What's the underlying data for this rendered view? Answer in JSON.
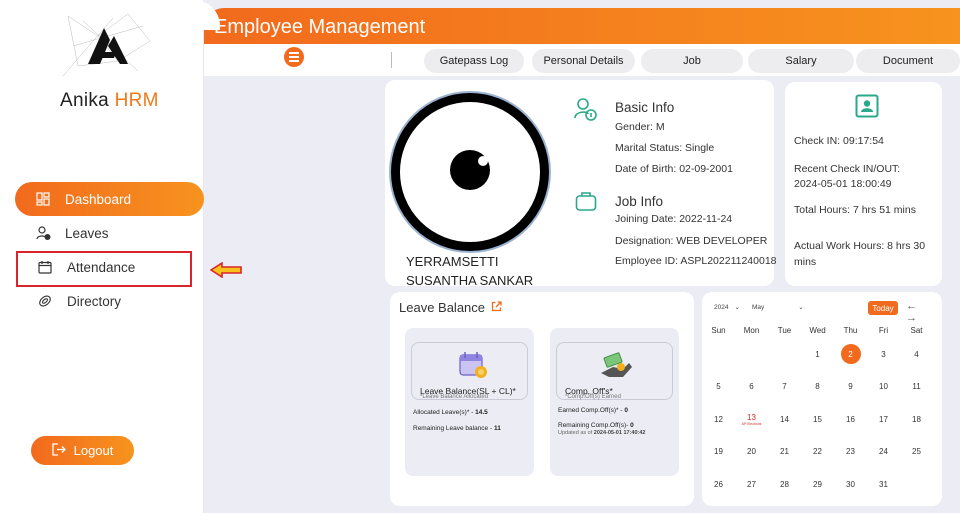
{
  "app": {
    "brand_main": "Anika",
    "brand_accent": "HRM"
  },
  "header": {
    "title": "Employee Management"
  },
  "sidebar": {
    "items": [
      {
        "label": "Dashboard",
        "icon": "dashboard-icon",
        "active": true
      },
      {
        "label": "Leaves",
        "icon": "leaves-icon",
        "active": false
      },
      {
        "label": "Attendance",
        "icon": "calendar-icon",
        "active": false
      },
      {
        "label": "Directory",
        "icon": "directory-icon",
        "active": false
      }
    ],
    "logout_label": "Logout"
  },
  "tabs": [
    "Gatepass Log",
    "Personal Details",
    "Job",
    "Salary",
    "Document"
  ],
  "profile": {
    "name_line1": "YERRAMSETTI",
    "name_line2": "SUSANTHA SANKAR",
    "basic_info_title": "Basic Info",
    "gender": "Gender: M",
    "marital": "Marital Status: Single",
    "dob": "Date of Birth: 02-09-2001",
    "job_info_title": "Job Info",
    "joining": "Joining Date: 2022-11-24",
    "designation": "Designation: WEB DEVELOPER",
    "employee_id": "Employee ID: ASPL202211240018"
  },
  "checkin": {
    "check_in": "Check IN: 09:17:54",
    "recent_label": "Recent Check IN/OUT:",
    "recent_value": "2024-05-01 18:00:49",
    "total_hours": "Total Hours: 7 hrs 51 mins",
    "actual_line1": "Actual Work Hours: 8 hrs 30",
    "actual_line2": "mins"
  },
  "leave_balance": {
    "title": "Leave Balance",
    "card1": {
      "name": "Leave Balance(SL + CL)*",
      "sub": "*Leave Balance Allocated",
      "allocated_label": "Allocated Leave(s)* - ",
      "allocated_value": "14.5",
      "remaining_label": "Remaining Leave balance - ",
      "remaining_value": "11"
    },
    "card2": {
      "name": "Comp. Off's*",
      "sub": "*Comp.Off(s) Earned",
      "earned_label": "Earned Comp.Off(s)* - ",
      "earned_value": "0",
      "remaining_label": "Remaining Comp.Off(s)- ",
      "remaining_value": "0",
      "updated_label": "Updated as of ",
      "updated_value": "2024-05-01 17:40:42"
    }
  },
  "calendar": {
    "year": "2024",
    "month": "May",
    "today_label": "Today",
    "arrows": "← →",
    "weekdays": [
      "Sun",
      "Mon",
      "Tue",
      "Wed",
      "Thu",
      "Fri",
      "Sat"
    ],
    "today_day": "2",
    "holiday_day": "13",
    "holiday_note": "AP Elections",
    "weeks": [
      [
        "",
        "",
        "",
        "1",
        "2",
        "3",
        "4"
      ],
      [
        "5",
        "6",
        "7",
        "8",
        "9",
        "10",
        "11"
      ],
      [
        "12",
        "13",
        "14",
        "15",
        "16",
        "17",
        "18"
      ],
      [
        "19",
        "20",
        "21",
        "22",
        "23",
        "24",
        "25"
      ],
      [
        "26",
        "27",
        "28",
        "29",
        "30",
        "31",
        ""
      ]
    ]
  },
  "colors": {
    "accent": "#f26a1d",
    "accent2": "#f7931e",
    "highlight": "#d9252a",
    "teal": "#2aa88a"
  }
}
